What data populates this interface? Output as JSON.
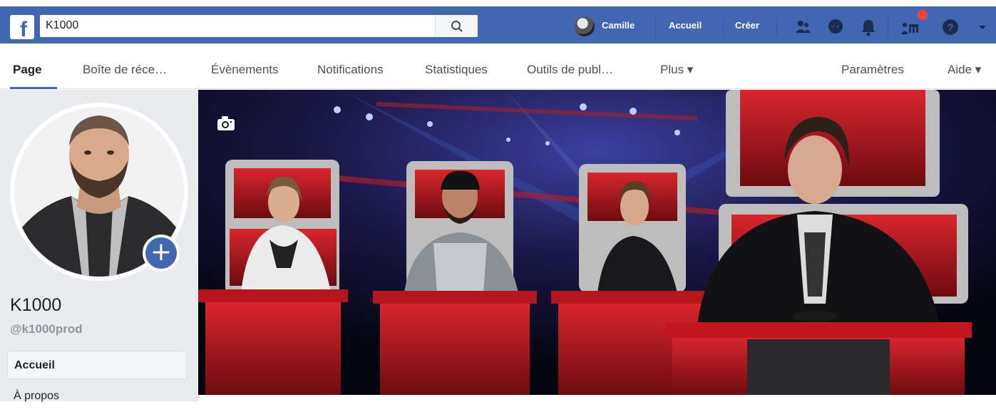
{
  "topbar": {
    "search_value": "K1000",
    "user_name": "Camille",
    "home_label": "Accueil",
    "create_label": "Créer"
  },
  "tabs": [
    {
      "label": "Page"
    },
    {
      "label": "Boîte de réce…"
    },
    {
      "label": "Évènements"
    },
    {
      "label": "Notifications"
    },
    {
      "label": "Statistiques"
    },
    {
      "label": "Outils de publ…"
    },
    {
      "label": "Plus ▾"
    },
    {
      "label": "Paramètres"
    },
    {
      "label": "Aide ▾"
    }
  ],
  "profile": {
    "name": "K1000",
    "handle": "@k1000prod"
  },
  "sidebar": {
    "items": [
      {
        "label": "Accueil"
      },
      {
        "label": "À propos"
      }
    ]
  },
  "colors": {
    "brand_blue": "#4267b2",
    "notification_red": "#fa3e3e"
  }
}
